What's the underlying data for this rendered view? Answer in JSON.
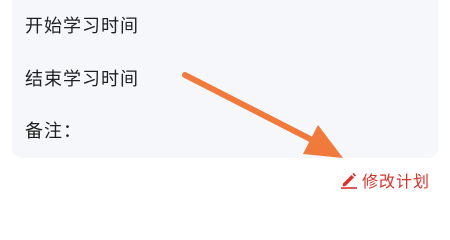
{
  "form": {
    "start_time_label": "开始学习时间",
    "end_time_label": "结束学习时间",
    "notes_label": "备注："
  },
  "actions": {
    "edit_plan_label": "修改计划",
    "edit_icon": "pencil-icon"
  },
  "colors": {
    "card_background": "#f6f7fb",
    "edit_link": "#d9322b",
    "arrow": "#f07a3c"
  }
}
